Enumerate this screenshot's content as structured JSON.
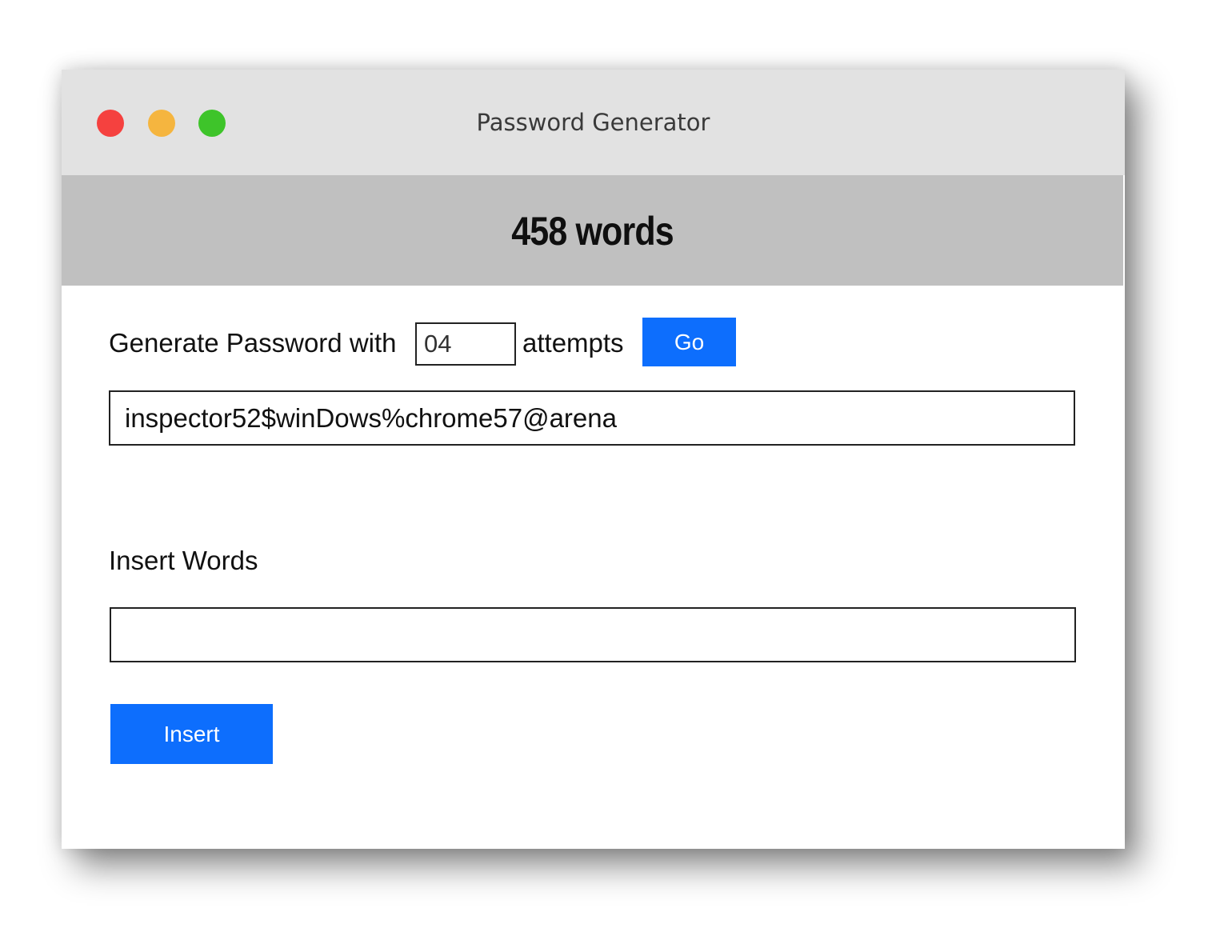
{
  "window": {
    "title": "Password Generator",
    "controls": {
      "close_color": "#f5413f",
      "minimize_color": "#f5b53f",
      "maximize_color": "#3ec42a"
    }
  },
  "banner": {
    "word_count_text": "458 words"
  },
  "generator": {
    "label_before": "Generate Password with",
    "attempts_value": "04",
    "label_after": "attempts",
    "go_label": "Go",
    "password_value": "inspector52$winDows%chrome57@arena"
  },
  "insert": {
    "heading": "Insert Words",
    "input_value": "",
    "button_label": "Insert"
  },
  "colors": {
    "accent": "#0d6efd",
    "titlebar": "#e2e2e2",
    "banner": "#c0c0c0"
  }
}
